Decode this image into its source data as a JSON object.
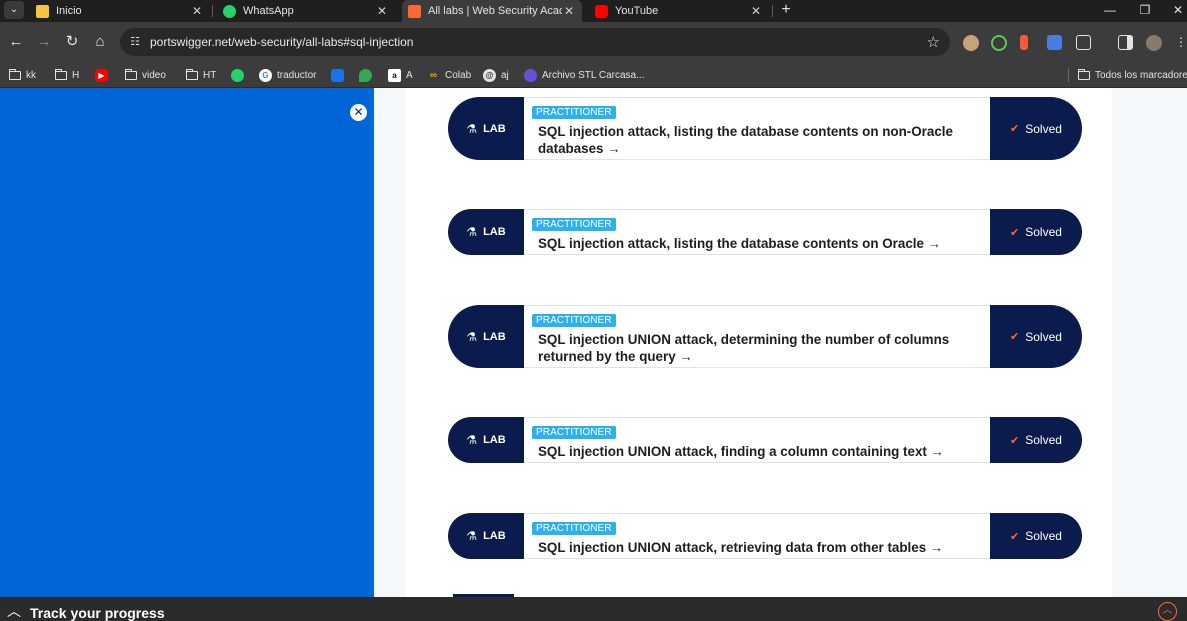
{
  "browser": {
    "tabs": [
      {
        "title": "Inicio",
        "favicon_color": "#f2c641"
      },
      {
        "title": "WhatsApp",
        "favicon_color": "#25d366"
      },
      {
        "title": "All labs | Web Security Academy",
        "favicon_color": "#ff6633"
      },
      {
        "title": "YouTube",
        "favicon_color": "#ff0000"
      }
    ],
    "new_tab_label": "+",
    "url": "portswigger.net/web-security/all-labs#sql-injection"
  },
  "bookmarks": {
    "items": [
      "kk",
      "H",
      "",
      "video",
      "HT",
      "",
      "traductor",
      "",
      "",
      "A",
      "Colab",
      "aj",
      "Archivo STL Carcasa..."
    ],
    "all_bookmarks": "Todos los marcadores"
  },
  "labs": [
    {
      "tag": "LAB",
      "level": "PRACTITIONER",
      "title": "SQL injection attack, listing the database contents on non-Oracle databases →",
      "status": "Solved"
    },
    {
      "tag": "LAB",
      "level": "PRACTITIONER",
      "title": "SQL injection attack, listing the database contents on Oracle →",
      "status": "Solved"
    },
    {
      "tag": "LAB",
      "level": "PRACTITIONER",
      "title": "SQL injection UNION attack, determining the number of columns returned by the query →",
      "status": "Solved"
    },
    {
      "tag": "LAB",
      "level": "PRACTITIONER",
      "title": "SQL injection UNION attack, finding a column containing text →",
      "status": "Solved"
    },
    {
      "tag": "LAB",
      "level": "PRACTITIONER",
      "title": "SQL injection UNION attack, retrieving data from other tables →",
      "status": "Solved"
    }
  ],
  "progress": {
    "label": "Track your progress"
  },
  "colors": {
    "sidebar": "#0066d8",
    "lab_dark": "#0c1b4d",
    "badge": "#2db0ee",
    "accent": "#ff6a3d"
  }
}
